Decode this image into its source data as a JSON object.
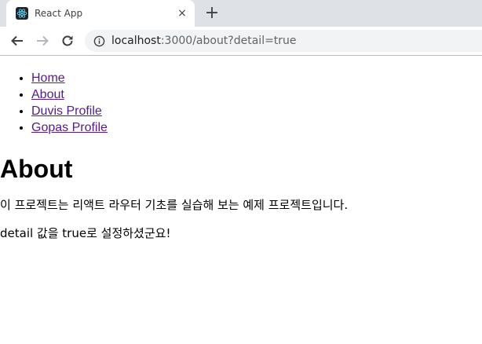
{
  "browser": {
    "tab": {
      "title": "React App",
      "favicon": "react-icon"
    },
    "new_tab_label": "+",
    "close_label": "×",
    "address": {
      "host": "localhost",
      "rest": ":3000/about?detail=true"
    }
  },
  "nav": {
    "items": [
      {
        "label": "Home"
      },
      {
        "label": "About"
      },
      {
        "label": "Duvis Profile"
      },
      {
        "label": "Gopas Profile"
      }
    ]
  },
  "page": {
    "title": "About",
    "description": "이 프로젝트는 리액트 라우터 기초를 실습해 보는 예제 프로젝트입니다.",
    "detail_message": "detail 값을 true로 설정하셨군요!"
  },
  "colors": {
    "tabstrip": "#dee1e6",
    "visited_link": "#551a8b",
    "react_logo": "#61dafb"
  }
}
